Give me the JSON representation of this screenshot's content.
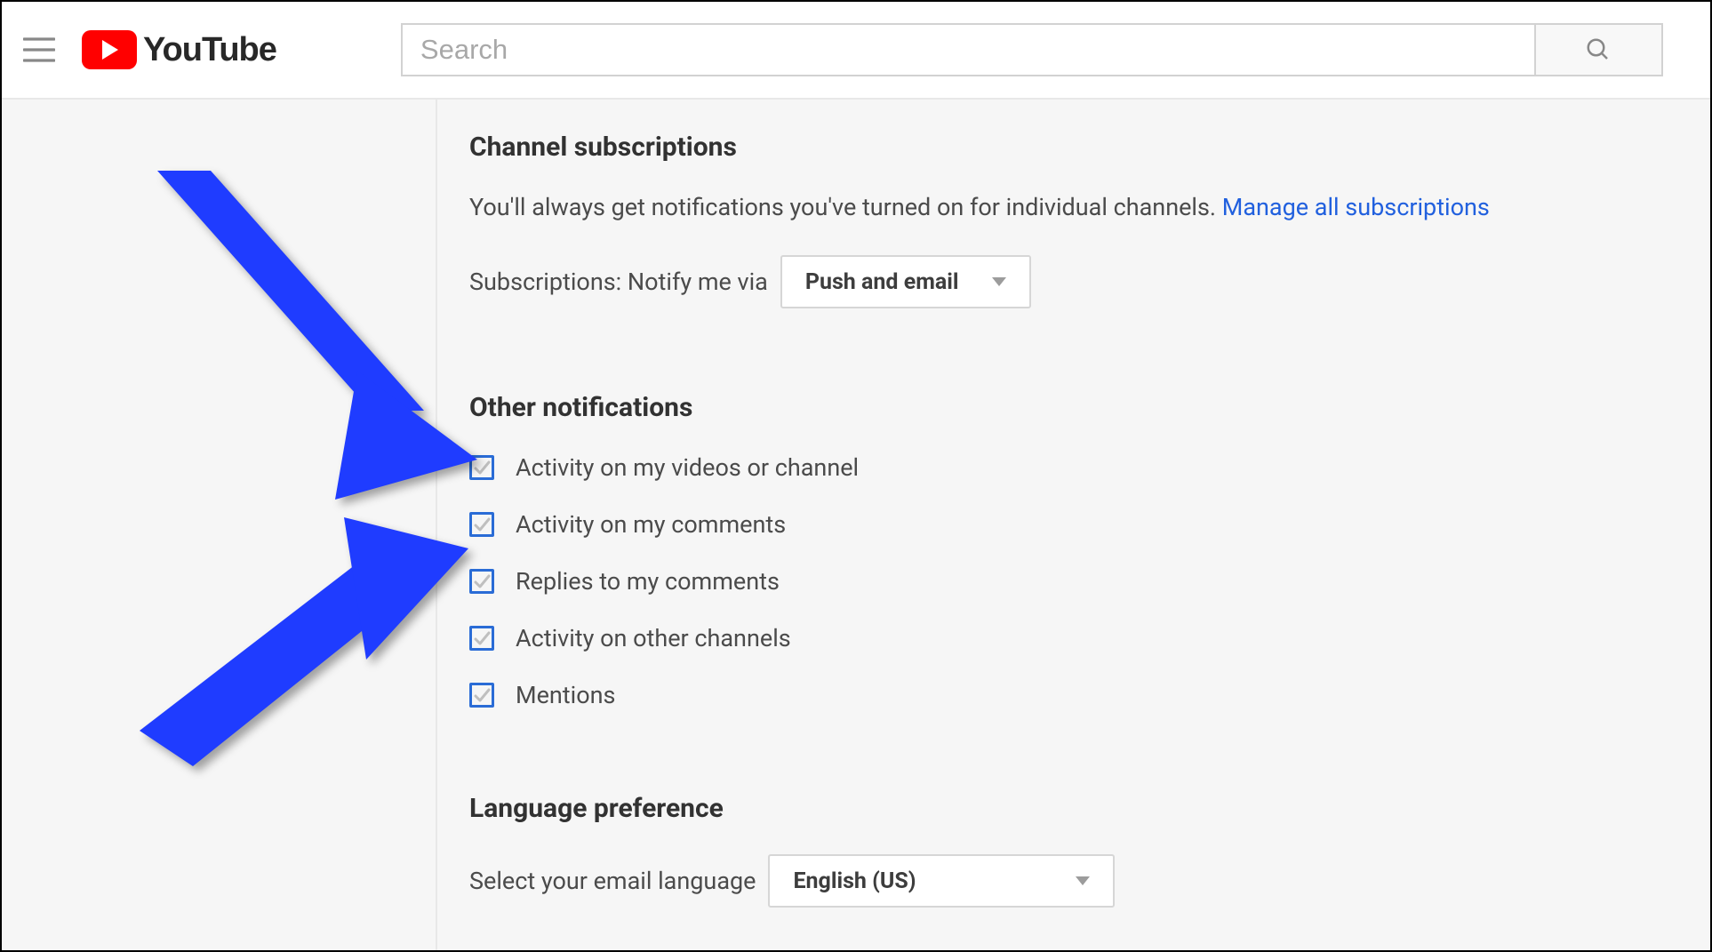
{
  "header": {
    "brand": "YouTube",
    "search_placeholder": "Search"
  },
  "sections": {
    "subscriptions": {
      "title": "Channel subscriptions",
      "description_prefix": "You'll always get notifications you've turned on for individual channels. ",
      "manage_link_label": "Manage all subscriptions",
      "notify_label": "Subscriptions: Notify me via",
      "notify_value": "Push and email"
    },
    "other": {
      "title": "Other notifications",
      "items": [
        {
          "label": "Activity on my videos or channel",
          "checked": true
        },
        {
          "label": "Activity on my comments",
          "checked": true
        },
        {
          "label": "Replies to my comments",
          "checked": true
        },
        {
          "label": "Activity on other channels",
          "checked": true
        },
        {
          "label": "Mentions",
          "checked": true
        }
      ]
    },
    "language": {
      "title": "Language preference",
      "select_label": "Select your email language",
      "select_value": "English (US)"
    }
  }
}
